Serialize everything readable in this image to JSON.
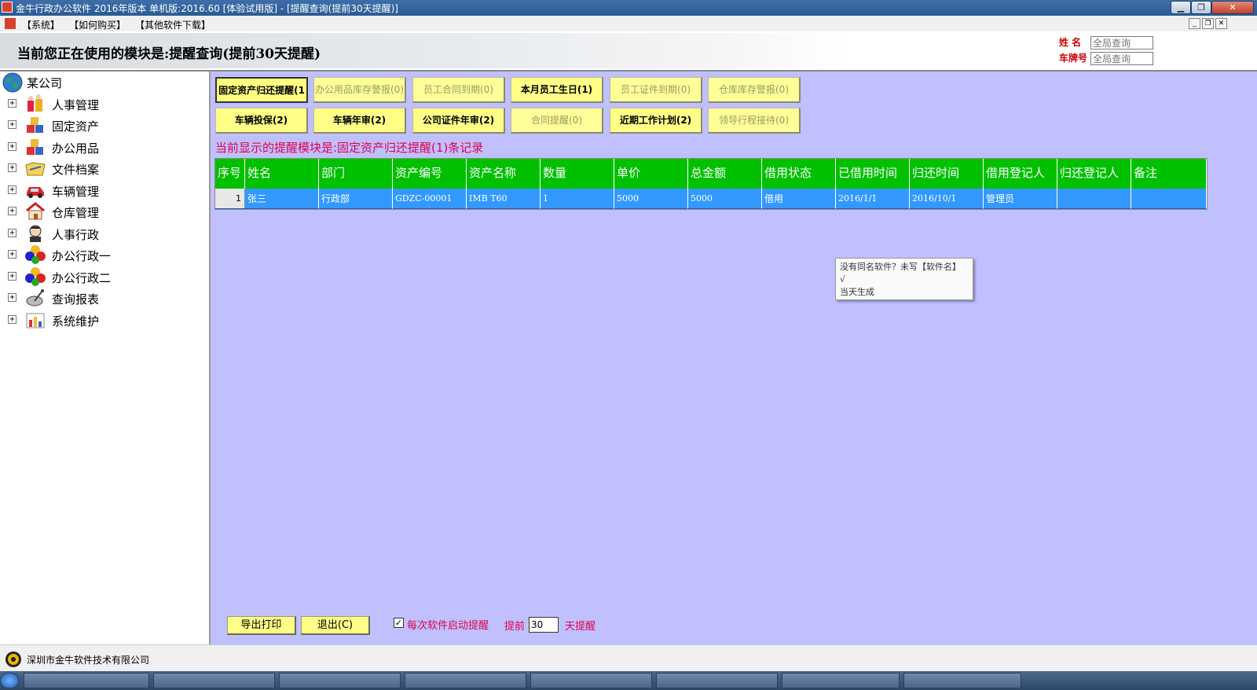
{
  "window": {
    "title": "金牛行政办公软件 2016年版本 单机版:2016.60 [体验试用版] - [提醒查询(提前30天提醒)]"
  },
  "menu": {
    "items": [
      "【系统】",
      "【如何购买】",
      "【其他软件下载】"
    ]
  },
  "banner": {
    "module_title": "当前您正在使用的模块是:提醒查询(提前30天提醒)",
    "name_label": "姓 名",
    "plate_label": "车牌号",
    "name_placeholder": "全局查询",
    "plate_placeholder": "全局查询"
  },
  "tree": {
    "root": "某公司",
    "items": [
      {
        "label": "人事管理",
        "icon": "people-icon"
      },
      {
        "label": "固定资产",
        "icon": "boxes-icon"
      },
      {
        "label": "办公用品",
        "icon": "boxes-icon"
      },
      {
        "label": "文件档案",
        "icon": "folder-icon"
      },
      {
        "label": "车辆管理",
        "icon": "car-icon"
      },
      {
        "label": "仓库管理",
        "icon": "house-icon"
      },
      {
        "label": "人事行政",
        "icon": "person-icon"
      },
      {
        "label": "办公行政一",
        "icon": "balls-icon"
      },
      {
        "label": "办公行政二",
        "icon": "balls-icon"
      },
      {
        "label": "查询报表",
        "icon": "satellite-icon"
      },
      {
        "label": "系统维护",
        "icon": "chart-icon"
      }
    ]
  },
  "tabs": {
    "row1": [
      {
        "label": "固定资产归还提醒(1",
        "state": "sel"
      },
      {
        "label": "办公用品库存警报(0)",
        "state": "dim"
      },
      {
        "label": "员工合同到期(0)",
        "state": "dim"
      },
      {
        "label": "本月员工生日(1)",
        "state": "active"
      },
      {
        "label": "员工证件到期(0)",
        "state": "dim"
      },
      {
        "label": "仓库库存警报(0)",
        "state": "dim"
      }
    ],
    "row2": [
      {
        "label": "车辆投保(2)",
        "state": "active"
      },
      {
        "label": "车辆年审(2)",
        "state": "active"
      },
      {
        "label": "公司证件年审(2)",
        "state": "active"
      },
      {
        "label": "合同提醒(0)",
        "state": "dim"
      },
      {
        "label": "近期工作计划(2)",
        "state": "active"
      },
      {
        "label": "领导行程接待(0)",
        "state": "dim"
      }
    ]
  },
  "status": {
    "text": "当前显示的提醒模块是:固定资产归还提醒(1)条记录"
  },
  "grid": {
    "columns": [
      "序号",
      "姓名",
      "部门",
      "资产编号",
      "资产名称",
      "数量",
      "单价",
      "总金额",
      "借用状态",
      "已借用时间",
      "归还时间",
      "借用登记人",
      "归还登记人",
      "备注"
    ],
    "rows": [
      [
        "1",
        "张三",
        "行政部",
        "GDZC-00001",
        "IMB T60",
        "1",
        "5000",
        "5000",
        "借用",
        "2016/1/1",
        "2016/10/1",
        "管理员",
        "",
        ""
      ]
    ]
  },
  "tooltip": {
    "line1": "没有同名软件？未写【软件名】",
    "line2": "√",
    "line3": "当天生成"
  },
  "bottom": {
    "export_label": "导出打印",
    "exit_label": "退出(C)",
    "startup_check_label": "每次软件启动提醒",
    "startup_checked": true,
    "check_mark": "✓",
    "advance_label": "提前",
    "days_value": "30",
    "days_suffix": "天提醒"
  },
  "footer": {
    "company": "深圳市金牛软件技术有限公司"
  },
  "colors": {
    "content_bg": "#c0c0ff",
    "header_green": "#00c000",
    "row_blue": "#3399ff",
    "button_yellow": "#ffff88",
    "alert_red": "#e0004e"
  }
}
